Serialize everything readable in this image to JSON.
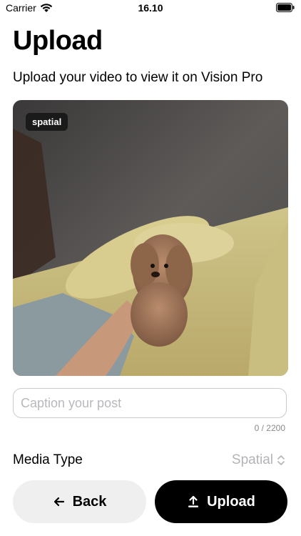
{
  "status_bar": {
    "carrier": "Carrier",
    "time": "16.10"
  },
  "header": {
    "title": "Upload",
    "subtitle": "Upload your video to view it on Vision Pro"
  },
  "media": {
    "badge": "spatial"
  },
  "caption": {
    "placeholder": "Caption your post",
    "value": "",
    "counter": "0 / 2200"
  },
  "media_type": {
    "label": "Media Type",
    "selected": "Spatial"
  },
  "actions": {
    "back_label": "Back",
    "upload_label": "Upload"
  },
  "icons": {
    "wifi": "wifi-icon",
    "battery": "battery-icon",
    "back": "arrow-left-icon",
    "upload": "upload-icon",
    "select": "chevron-updown-icon"
  }
}
